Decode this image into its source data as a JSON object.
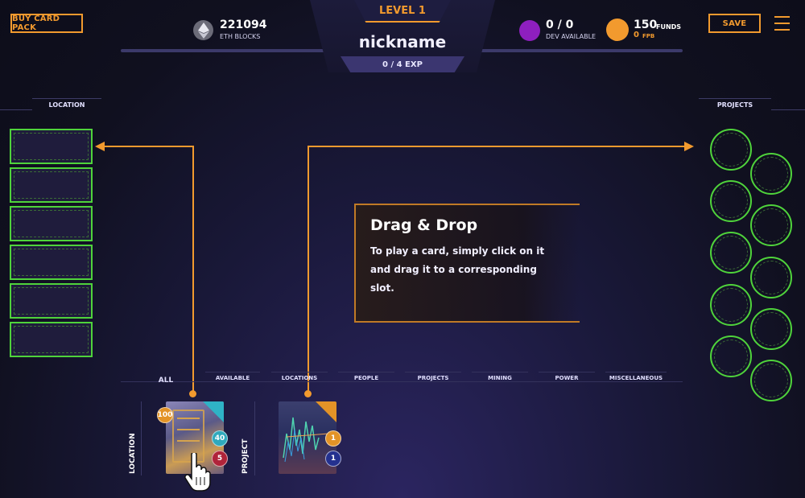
{
  "header": {
    "buy_card_pack": "BUY CARD PACK",
    "save": "SAVE",
    "eth_blocks_value": "221094",
    "eth_blocks_label": "ETH BLOCKS",
    "level": "LEVEL 1",
    "nickname": "nickname",
    "exp": "0 / 4 EXP",
    "dev_value": "0 / 0",
    "dev_label": "DEV AVAILABLE",
    "funds_value": "150",
    "funds_label": "FUNDS",
    "fpb_value": "0",
    "fpb_label": "FPB"
  },
  "sections": {
    "location": "LOCATION",
    "projects": "PROJECTS"
  },
  "tooltip": {
    "title": "Drag & Drop",
    "body": "To play a card, simply click on it and drag it to a corresponding slot."
  },
  "tabs": [
    "ALL",
    "AVAILABLE",
    "LOCATIONS",
    "PEOPLE",
    "PROJECTS",
    "MINING",
    "POWER",
    "MISCELLANEOUS"
  ],
  "cards": {
    "location": {
      "label": "LOCATION",
      "cost": "100",
      "value_a": "40",
      "value_b": "5"
    },
    "project": {
      "label": "PROJECT",
      "value_a": "1",
      "value_b": "1"
    }
  },
  "colors": {
    "accent": "#f29a2e",
    "slot_green": "#4fd33b",
    "dev_purple": "#8e1fbf",
    "funds_orange": "#f29a2e"
  },
  "icons": {
    "eth": "ethereum-icon",
    "menu": "hamburger-menu-icon",
    "cursor": "hand-pointer-icon"
  }
}
